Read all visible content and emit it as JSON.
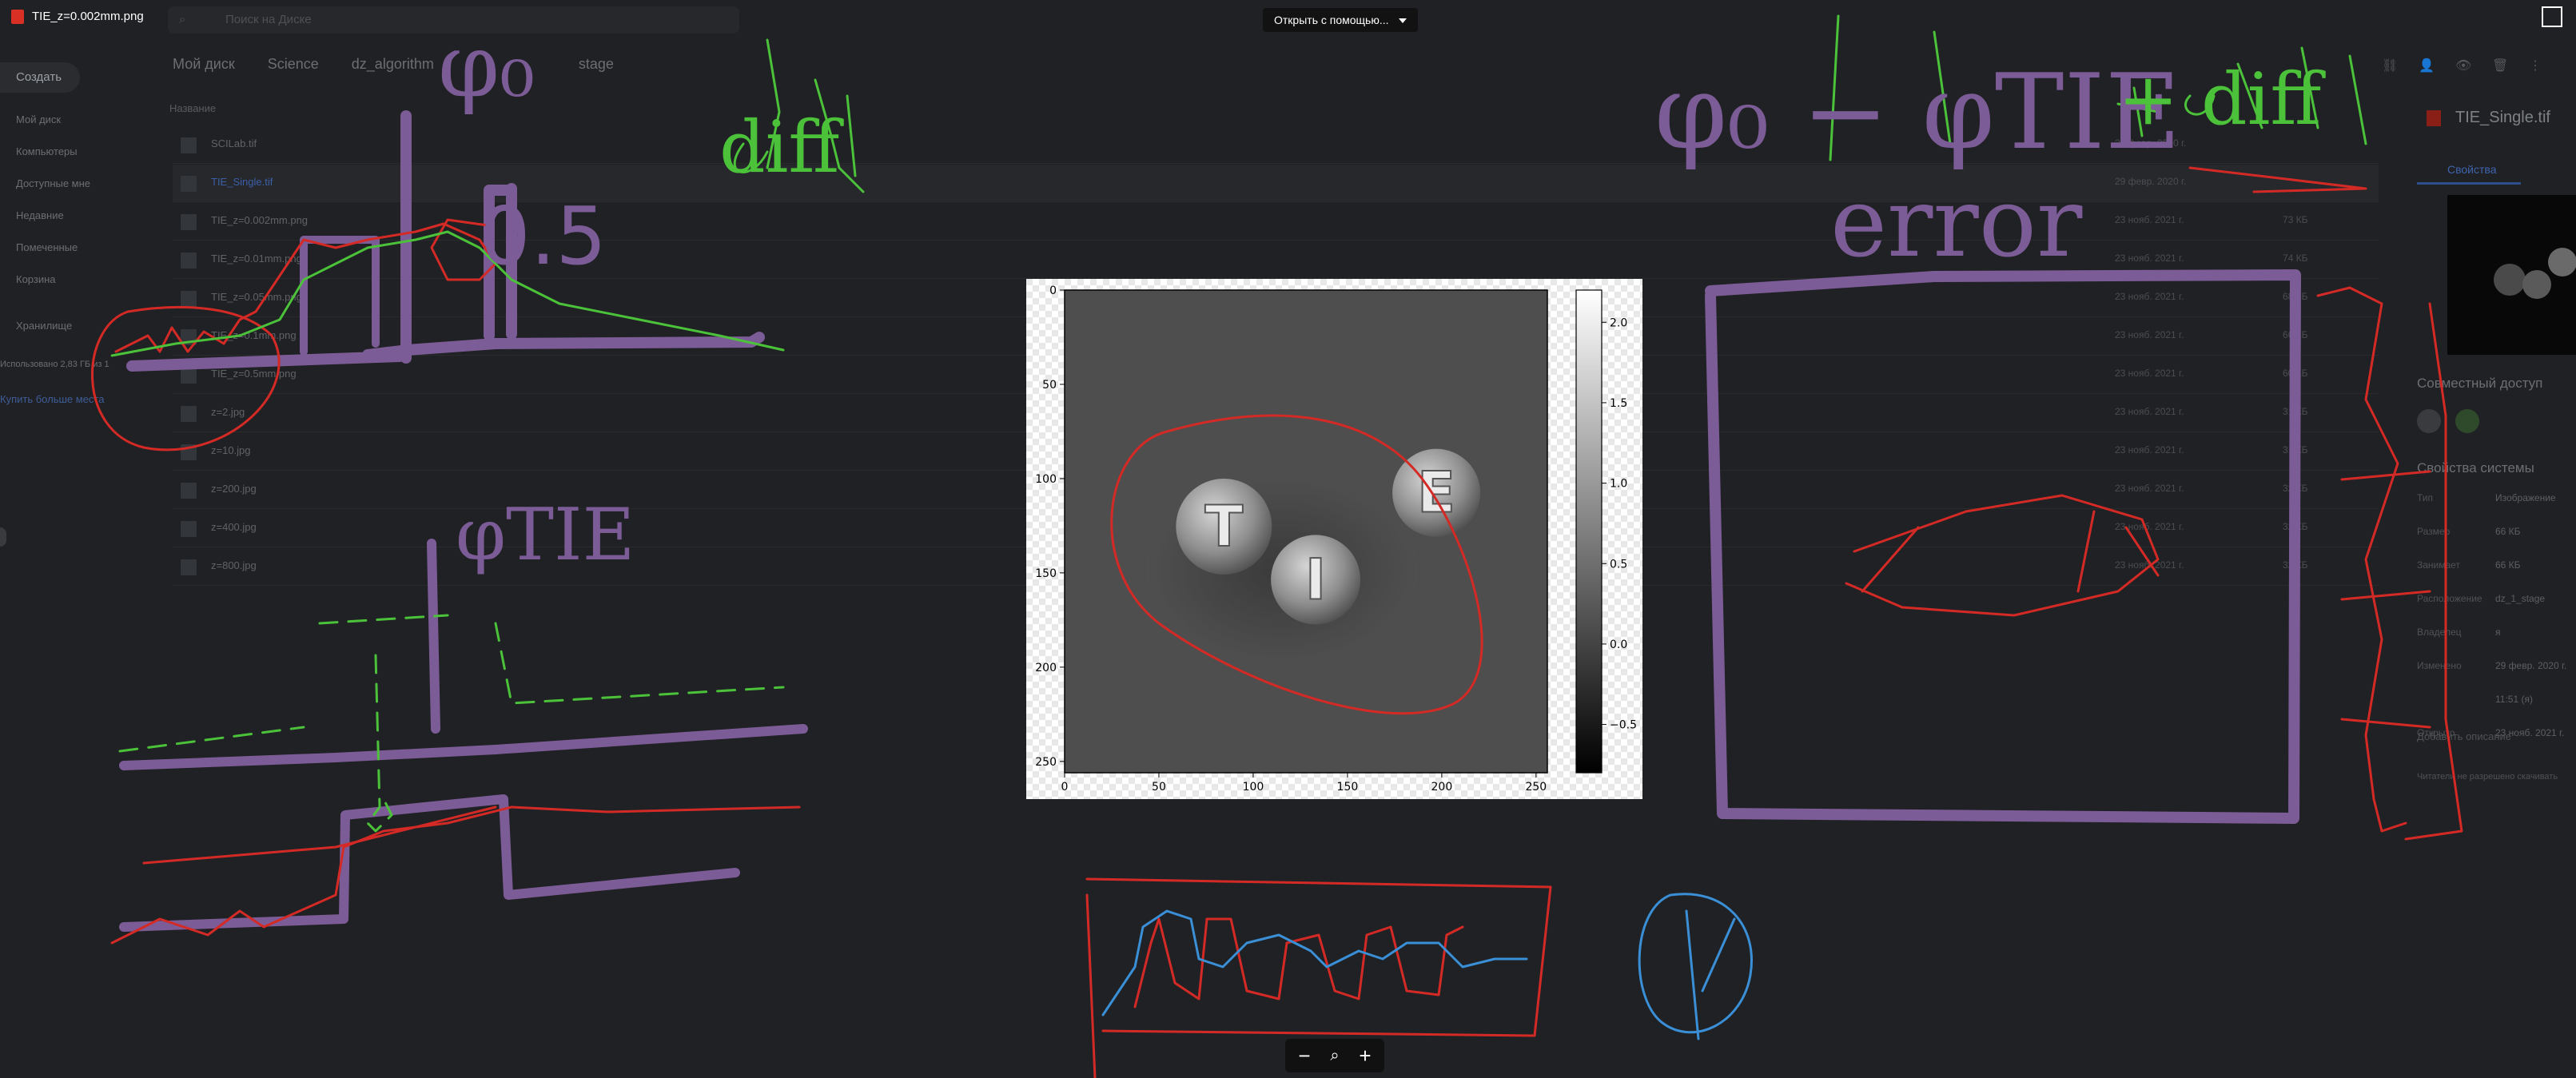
{
  "viewer": {
    "file_title": "TIE_z=0.002mm.png",
    "open_with_label": "Открыть с помощью...",
    "zoom_out": "−",
    "zoom_icon": "magnifier-icon",
    "zoom_in": "+"
  },
  "drive": {
    "search_placeholder": "Поиск на Диске",
    "create_label": "Создать",
    "sidebar": [
      "Мой диск",
      "Компьютеры",
      "Доступные мне",
      "Недавние",
      "Помеченные",
      "Корзина",
      "Хранилище"
    ],
    "storage_text": "Использовано 2,83 ГБ из 1",
    "buy_storage": "Купить больше места",
    "breadcrumb": [
      "Мой диск",
      "Science",
      "dz_algorithm",
      "stage"
    ],
    "name_header": "Название",
    "files": [
      {
        "name": "SCILab.tif",
        "date": "29 февр. 2020 г.",
        "size": ""
      },
      {
        "name": "TIE_Single.tif",
        "date": "29 февр. 2020 г.",
        "size": "",
        "selected": true
      },
      {
        "name": "TIE_z=0.002mm.png",
        "date": "23 нояб. 2021 г.",
        "size": "73 КБ"
      },
      {
        "name": "TIE_z=0.01mm.png",
        "date": "23 нояб. 2021 г.",
        "size": "74 КБ"
      },
      {
        "name": "TIE_z=0.05mm.png",
        "date": "23 нояб. 2021 г.",
        "size": "68 КБ"
      },
      {
        "name": "TIE_z=0.1mm.png",
        "date": "23 нояб. 2021 г.",
        "size": "66 КБ"
      },
      {
        "name": "TIE_z=0.5mm.png",
        "date": "23 нояб. 2021 г.",
        "size": "60 КБ"
      },
      {
        "name": "z=2.jpg",
        "date": "23 нояб. 2021 г.",
        "size": "31 КБ"
      },
      {
        "name": "z=10.jpg",
        "date": "23 нояб. 2021 г.",
        "size": "31 КБ"
      },
      {
        "name": "z=200.jpg",
        "date": "23 нояб. 2021 г.",
        "size": "32 КБ"
      },
      {
        "name": "z=400.jpg",
        "date": "23 нояб. 2021 г.",
        "size": "32 КБ"
      },
      {
        "name": "z=800.jpg",
        "date": "23 нояб. 2021 г.",
        "size": "32 КБ"
      }
    ],
    "details": {
      "title": "TIE_Single.tif",
      "tab": "Свойства",
      "sharing_header": "Совместный доступ",
      "props_header": "Свойства системы",
      "props": [
        {
          "k": "Тип",
          "v": "Изображение"
        },
        {
          "k": "Размер",
          "v": "66 КБ"
        },
        {
          "k": "Занимает",
          "v": "66 КБ"
        },
        {
          "k": "Расположение",
          "v": "dz_1_stage"
        },
        {
          "k": "Владелец",
          "v": "я"
        },
        {
          "k": "Изменено",
          "v": "29 февр. 2020 г."
        },
        {
          "k": "",
          "v": "11:51 (я)"
        },
        {
          "k": "Открыто",
          "v": "23 нояб. 2021 г."
        }
      ],
      "add_desc": "Добавить описание",
      "perm_note": "Читатели не разрешено скачивать"
    }
  },
  "annotations": {
    "phi0": "φ₀",
    "diff_top": "diff",
    "half": "0.5",
    "phi_tie": "φTIE",
    "formula": "φ₀ − φTIE",
    "plus_diff": "+ diff",
    "error": "error"
  },
  "chart_data": {
    "type": "heatmap",
    "title": "",
    "xlabel": "",
    "ylabel": "",
    "xticks": [
      "0",
      "50",
      "100",
      "150",
      "200",
      "250"
    ],
    "yticks": [
      "0",
      "50",
      "100",
      "150",
      "200",
      "250"
    ],
    "xlim": [
      0,
      256
    ],
    "ylim": [
      256,
      0
    ],
    "colormap": "gray",
    "colorbar_ticks": [
      "2.0",
      "1.5",
      "1.0",
      "0.5",
      "0.0",
      "−0.5"
    ],
    "colorbar_range": [
      -0.8,
      2.2
    ],
    "image_letters": [
      "T",
      "I",
      "E"
    ]
  }
}
